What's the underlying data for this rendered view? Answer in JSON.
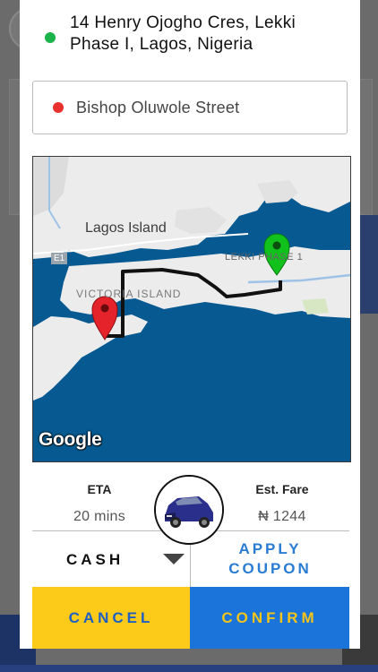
{
  "trip": {
    "origin": "14 Henry Ojogho Cres, Lekki Phase I, Lagos, Nigeria",
    "destination": "Bishop Oluwole Street"
  },
  "map": {
    "labels": {
      "lagos_island": "Lagos Island",
      "lekki": "LEKKI PHASE 1",
      "victoria_island": "VICTORIA ISLAND",
      "road_badge": "E1",
      "attribution": "Google"
    },
    "colors": {
      "water": "#065a91",
      "land": "#ececec",
      "route": "#111111",
      "origin_pin": "#1bb34a",
      "destination_pin": "#e8312e"
    }
  },
  "estimate": {
    "eta_label": "ETA",
    "eta_value": "20 mins",
    "fare_label": "Est. Fare",
    "fare_value": "₦ 1244"
  },
  "payment": {
    "method": "CASH",
    "coupon_line1": "APPLY",
    "coupon_line2": "COUPON"
  },
  "actions": {
    "cancel": "CANCEL",
    "confirm": "CONFIRM"
  },
  "colors": {
    "cancel_bg": "#fccb1a",
    "confirm_bg": "#1a74d9",
    "accent_blue": "#2a7cd3"
  }
}
